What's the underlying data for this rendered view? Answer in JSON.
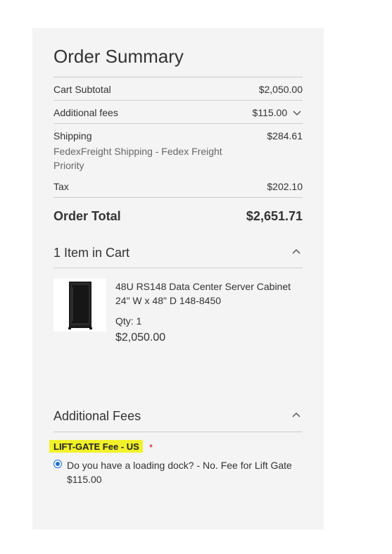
{
  "summary": {
    "title": "Order Summary",
    "cart_subtotal_label": "Cart Subtotal",
    "cart_subtotal_value": "$2,050.00",
    "additional_fees_label": "Additional fees",
    "additional_fees_value": "$115.00",
    "shipping_label": "Shipping",
    "shipping_value": "$284.61",
    "shipping_method_line1": "FedexFreight Shipping - Fedex Freight",
    "shipping_method_line2": "Priority",
    "tax_label": "Tax",
    "tax_value": "$202.10",
    "order_total_label": "Order Total",
    "order_total_value": "$2,651.71"
  },
  "cart": {
    "title": "1 Item in Cart",
    "item": {
      "name_line1": "48U RS148 Data Center Server Cabinet",
      "name_line2": "24\" W x 48\" D 148-8450",
      "qty": "Qty: 1",
      "price": "$2,050.00"
    }
  },
  "fees": {
    "title": "Additional Fees",
    "fee_name": "LIFT-GATE Fee - US",
    "required_marker": "*",
    "option_line1": "Do you have a loading dock? - No. Fee for Lift Gate",
    "option_line2": "$115.00"
  },
  "icons": {
    "fees_toggle": "chevron-down-icon",
    "cart_toggle": "chevron-up-icon",
    "fees_section_toggle": "chevron-up-icon"
  },
  "colors": {
    "panel_bg": "#f4f4f4",
    "highlight": "#f2f22a",
    "required": "#d00000",
    "radio_accent": "#1a6fd8"
  }
}
